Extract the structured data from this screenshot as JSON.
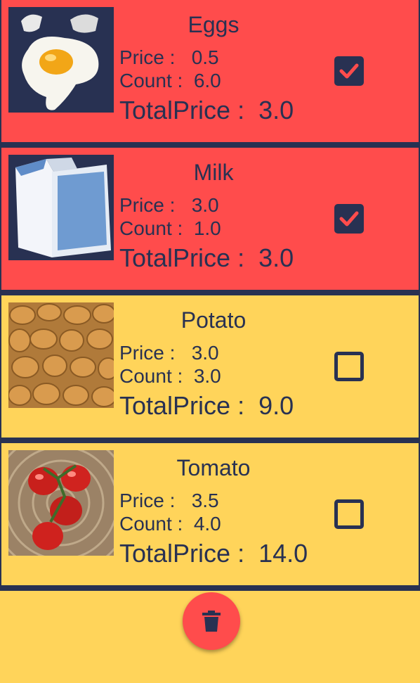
{
  "colors": {
    "checked_row": "#FF4C4C",
    "unchecked_row": "#FFD45A",
    "text_and_divider": "#283152",
    "fab": "#FF4C4C"
  },
  "items": [
    {
      "name": "Eggs",
      "price_text": "Price :   0.5",
      "count_text": "Count :  6.0",
      "total_text": "TotalPrice :  3.0",
      "checked": true,
      "image_icon": "eggs-image"
    },
    {
      "name": "Milk",
      "price_text": "Price :   3.0",
      "count_text": "Count :  1.0",
      "total_text": "TotalPrice :  3.0",
      "checked": true,
      "image_icon": "milk-image"
    },
    {
      "name": "Potato",
      "price_text": "Price :   3.0",
      "count_text": "Count :  3.0",
      "total_text": "TotalPrice :  9.0",
      "checked": false,
      "image_icon": "potato-image"
    },
    {
      "name": "Tomato",
      "price_text": "Price :   3.5",
      "count_text": "Count :  4.0",
      "total_text": "TotalPrice :  14.0",
      "checked": false,
      "image_icon": "tomato-image"
    }
  ],
  "fab": {
    "icon": "trash-icon"
  }
}
